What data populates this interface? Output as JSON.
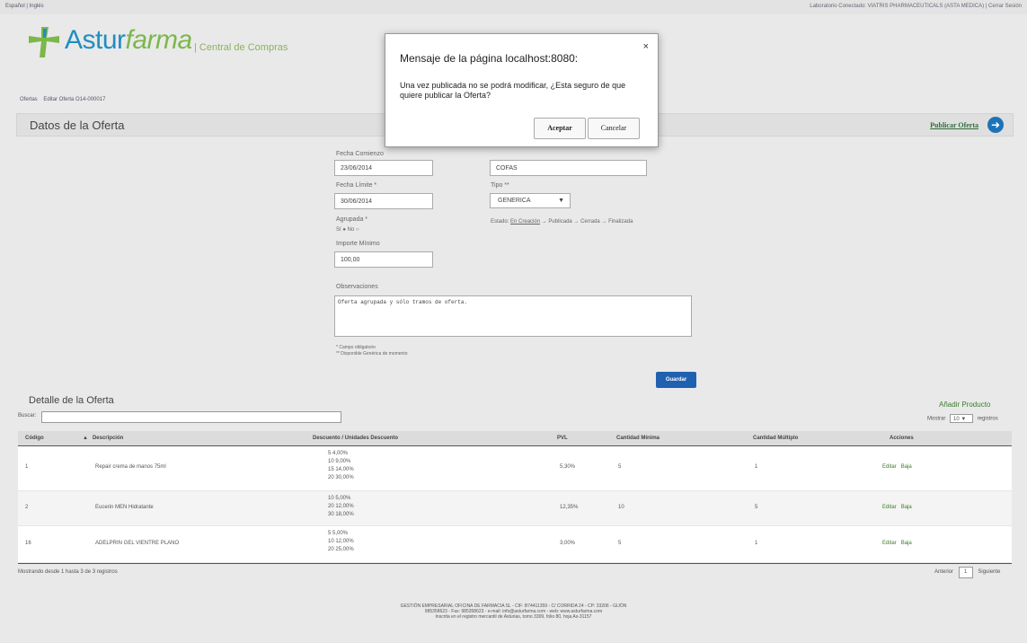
{
  "topbar": {
    "lang_es": "Español",
    "lang_sep": "|",
    "lang_en": "Inglés",
    "lab_label": "Laboratorio Conectado: VIATRIS PHARMACEUTICALS (ASTA MEDICA)",
    "logout": "Cerrar Sesión"
  },
  "logo": {
    "brand_part1": "Astur",
    "brand_part2": "farma",
    "subtitle": "| Central de Compras"
  },
  "breadcrumb": {
    "item1": "Ofertas",
    "item2": "Editar Oferta O14-000017"
  },
  "header": {
    "title": "Datos de la Oferta",
    "publish": "Publicar Oferta",
    "circle_icon": "arrow-icon"
  },
  "form": {
    "fecha_comienzo_label": "Fecha Comienzo",
    "fecha_comienzo": "23/06/2014",
    "fecha_limite_label": "Fecha Límite *",
    "fecha_limite": "30/06/2014",
    "agrupada_label": "Agrupada *",
    "agrupada_options": "Sí ● No ○",
    "importe_label": "Importe Mínimo",
    "importe": "100,00",
    "cofas": "COFAS",
    "tipo_label": "Tipo **",
    "tipo_value": "GENERICA",
    "estado_prefix": "Estado:",
    "estado_current": "En Creación",
    "estado_rest": "→ Publicada → Cerrada → Finalizada",
    "observaciones_label": "Observaciones",
    "observaciones": "Oferta agrupada y sólo tramos de oferta.",
    "note1": "* Campo obligatorio",
    "note2": "** Disponible Genérica de momento",
    "guardar": "Guardar"
  },
  "detail": {
    "title": "Detalle de la Oferta",
    "add_product": "Añadir Producto",
    "search_label": "Buscar:",
    "show_label": "Mostrar",
    "show_value": "10",
    "show_suffix": "registros",
    "columns": [
      "Código",
      "Descripción",
      "Descuento / Unidades Descuento",
      "PVL",
      "Cantidad Mínima",
      "Cantidad Múltiplo",
      "Acciones"
    ],
    "rows": [
      {
        "codigo": "1",
        "descripcion": "Repair crema de manos 75ml",
        "descuentos": [
          "5 4,00%",
          "10 9,00%",
          "15 14,00%",
          "20 30,00%"
        ],
        "pvl": "5,30%",
        "min": "5",
        "mult": "1",
        "editar": "Editar",
        "baja": "Baja"
      },
      {
        "codigo": "2",
        "descripcion": "Eucerin MEN Hidratante",
        "descuentos": [
          "10 5,00%",
          "20 12,00%",
          "30 18,00%"
        ],
        "pvl": "12,35%",
        "min": "10",
        "mult": "5",
        "editar": "Editar",
        "baja": "Baja"
      },
      {
        "codigo": "16",
        "descripcion": "ADELPRIN GEL VIENTRE PLANO",
        "descuentos": [
          "5 5,00%",
          "10 12,00%",
          "20 25,00%"
        ],
        "pvl": "3,00%",
        "min": "5",
        "mult": "1",
        "editar": "Editar",
        "baja": "Baja"
      }
    ],
    "info": "Mostrando desde 1 hasta 3 de 3 registros",
    "prev": "Anterior",
    "page": "1",
    "next": "Siguiente"
  },
  "footer": {
    "line1": "GESTIÓN EMPRESARIAL OFICINA DE FARMACIA SL - CIF: B74411359 - C/ CORRIDA 24 - CP: 33206 - GIJÓN",
    "line2": "985358623 - Fax: 985358623 - e-mail: info@asturfarma.com - web: www.asturfarma.com",
    "line3": "Inscrita en el registro mercantil de Asturias, tomo 3309, folio 80, hoja As-31157"
  },
  "dialog": {
    "title": "Mensaje de la página localhost:8080:",
    "close": "×",
    "message": "Una vez publicada no se podrá modificar, ¿Esta seguro de que quiere publicar la Oferta?",
    "accept": "Aceptar",
    "cancel": "Cancelar"
  }
}
